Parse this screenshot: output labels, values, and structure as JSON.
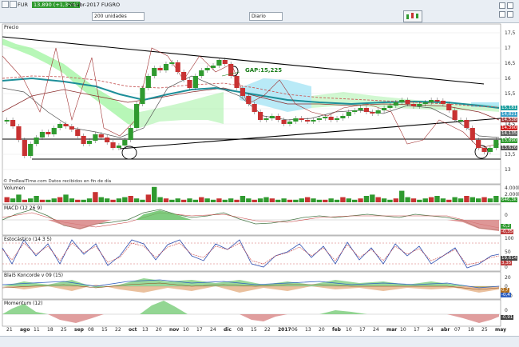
{
  "header": {
    "symbol": "FUR",
    "price_badge": "13,890 (+1,35%)",
    "title": "26-abr-2017 FUGRO",
    "units_select": "200 unidades",
    "period_select": "Diario"
  },
  "panels": {
    "price": "Precio",
    "volume": "Volumen",
    "macd": "MACD (12 26 9)",
    "stoch": "Estocástico (14 3 5)",
    "blai": "Blai5 Koncorde v 09 (15)",
    "momentum": "Momentum (12)"
  },
  "price_axis": [
    "17,5",
    "17",
    "16,5",
    "16",
    "15,5",
    "15",
    "14,5",
    "14",
    "13,5",
    "13"
  ],
  "price_boxes": [
    {
      "label": "15,181",
      "color": "#1d9e9e"
    },
    {
      "label": "14,821",
      "color": "#39a0c8"
    },
    {
      "label": "14,538",
      "color": "#a04040"
    },
    {
      "label": "14,390",
      "color": "#d02020"
    },
    {
      "label": "14,135",
      "color": "#606060"
    },
    {
      "label": "13,890",
      "color": "#2f9a2f"
    },
    {
      "label": "13,626",
      "color": "#555555"
    }
  ],
  "annotation": {
    "gap": "GAP:15,225"
  },
  "source_note": "© ProRealTime.com  Datos recibidos en fin de día",
  "volume_axis": [
    "4.000k",
    "2.000k"
  ],
  "volume_boxes": [
    {
      "label": "646,3k",
      "color": "#2f9a2f"
    }
  ],
  "macd_axis": [
    "0"
  ],
  "macd_boxes": [
    {
      "label": "-0,2",
      "color": "#2f9a2f"
    },
    {
      "label": "-0,35",
      "color": "#c04040"
    }
  ],
  "stoch_axis": [
    "100",
    "50",
    "0"
  ],
  "stoch_boxes": [
    {
      "label": "19,614",
      "color": "#444"
    },
    {
      "label": "3,35",
      "color": "#c04040"
    }
  ],
  "blai_axis": [
    "20",
    "0",
    "-20"
  ],
  "blai_boxes": [
    {
      "label": "0,7",
      "color": "#b07020"
    },
    {
      "label": "-0,4",
      "color": "#3060c0"
    }
  ],
  "momentum_axis": [
    "0"
  ],
  "momentum_boxes": [
    {
      "label": "-0,91",
      "color": "#444"
    }
  ],
  "x_axis": [
    {
      "t": "21",
      "b": false
    },
    {
      "t": "ago",
      "b": true
    },
    {
      "t": "11",
      "b": false
    },
    {
      "t": "18",
      "b": false
    },
    {
      "t": "25",
      "b": false
    },
    {
      "t": "sep",
      "b": true
    },
    {
      "t": "08",
      "b": false
    },
    {
      "t": "15",
      "b": false
    },
    {
      "t": "22",
      "b": false
    },
    {
      "t": "oct",
      "b": true
    },
    {
      "t": "13",
      "b": false
    },
    {
      "t": "20",
      "b": false
    },
    {
      "t": "nov",
      "b": true
    },
    {
      "t": "10",
      "b": false
    },
    {
      "t": "17",
      "b": false
    },
    {
      "t": "24",
      "b": false
    },
    {
      "t": "dic",
      "b": true
    },
    {
      "t": "08",
      "b": false
    },
    {
      "t": "15",
      "b": false
    },
    {
      "t": "22",
      "b": false
    },
    {
      "t": "2017",
      "b": true
    },
    {
      "t": "06",
      "b": false
    },
    {
      "t": "13",
      "b": false
    },
    {
      "t": "20",
      "b": false
    },
    {
      "t": "feb",
      "b": true
    },
    {
      "t": "10",
      "b": false
    },
    {
      "t": "17",
      "b": false
    },
    {
      "t": "24",
      "b": false
    },
    {
      "t": "mar",
      "b": true
    },
    {
      "t": "10",
      "b": false
    },
    {
      "t": "17",
      "b": false
    },
    {
      "t": "24",
      "b": false
    },
    {
      "t": "abr",
      "b": true
    },
    {
      "t": "07",
      "b": false
    },
    {
      "t": "18",
      "b": false
    },
    {
      "t": "25",
      "b": false
    },
    {
      "t": "may",
      "b": true
    }
  ],
  "colors": {
    "up": "#2f9a2f",
    "down": "#c83232",
    "ma_teal": "#1d8f9a",
    "trend": "#000000"
  }
}
